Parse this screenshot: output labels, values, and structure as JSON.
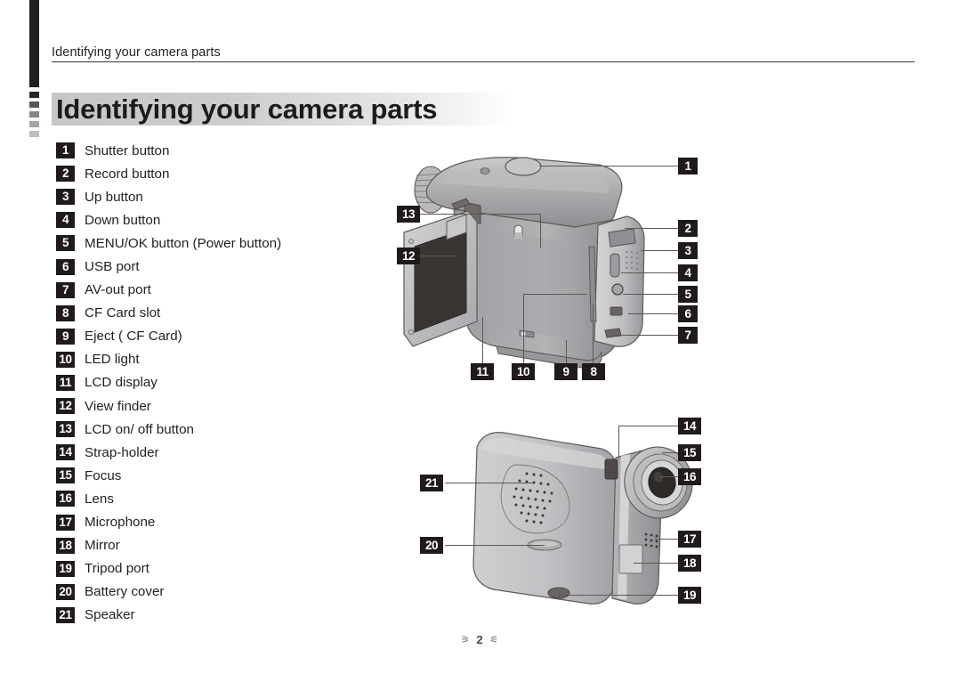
{
  "running_head": "Identifying your camera parts",
  "title": "Identifying your camera parts",
  "parts": [
    {
      "num": "1",
      "label": "Shutter button"
    },
    {
      "num": "2",
      "label": "Record button"
    },
    {
      "num": "3",
      "label": "Up button"
    },
    {
      "num": "4",
      "label": "Down button"
    },
    {
      "num": "5",
      "label": "MENU/OK button (Power button)"
    },
    {
      "num": "6",
      "label": "USB port"
    },
    {
      "num": "7",
      "label": "AV-out port"
    },
    {
      "num": "8",
      "label": "CF Card slot"
    },
    {
      "num": "9",
      "label": "Eject ( CF Card)"
    },
    {
      "num": "10",
      "label": "LED light"
    },
    {
      "num": "11",
      "label": "LCD display"
    },
    {
      "num": "12",
      "label": "View finder"
    },
    {
      "num": "13",
      "label": "LCD on/ off button"
    },
    {
      "num": "14",
      "label": "Strap-holder"
    },
    {
      "num": "15",
      "label": "Focus"
    },
    {
      "num": "16",
      "label": "Lens"
    },
    {
      "num": "17",
      "label": "Microphone"
    },
    {
      "num": "18",
      "label": "Mirror"
    },
    {
      "num": "19",
      "label": "Tripod port"
    },
    {
      "num": "20",
      "label": "Battery cover"
    },
    {
      "num": "21",
      "label": "Speaker"
    }
  ],
  "figure_top": {
    "name": "camera-rear-three-quarter-view",
    "callouts": [
      "1",
      "2",
      "3",
      "4",
      "5",
      "6",
      "7",
      "8",
      "9",
      "10",
      "11",
      "12",
      "13"
    ]
  },
  "figure_bottom": {
    "name": "camera-front-three-quarter-view",
    "callouts": [
      "14",
      "15",
      "16",
      "17",
      "18",
      "19",
      "20",
      "21"
    ]
  },
  "footer": {
    "ornament_left": "⚞",
    "page_number": "2",
    "ornament_right": "⚟"
  },
  "colors": {
    "ink": "#231f20",
    "callout_bg": "#201a1a",
    "leader": "#5d5755",
    "body_light": "#d8d8d8",
    "body_mid": "#b4b4b6",
    "body_dark": "#8d8d91",
    "screen": "#3a3533"
  }
}
